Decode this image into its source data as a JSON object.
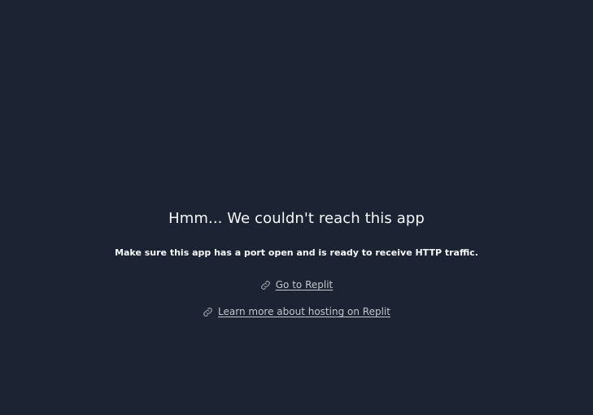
{
  "error": {
    "title": "Hmm... We couldn't reach this app",
    "message": "Make sure this app has a port open and is ready to receive HTTP traffic."
  },
  "links": [
    {
      "label": "Go to Replit",
      "icon": "link-icon"
    },
    {
      "label": "Learn more about hosting on Replit",
      "icon": "link-icon"
    }
  ],
  "colors": {
    "background": "#1c2333",
    "title": "#f5f9fc",
    "link": "#c2c8cc"
  }
}
